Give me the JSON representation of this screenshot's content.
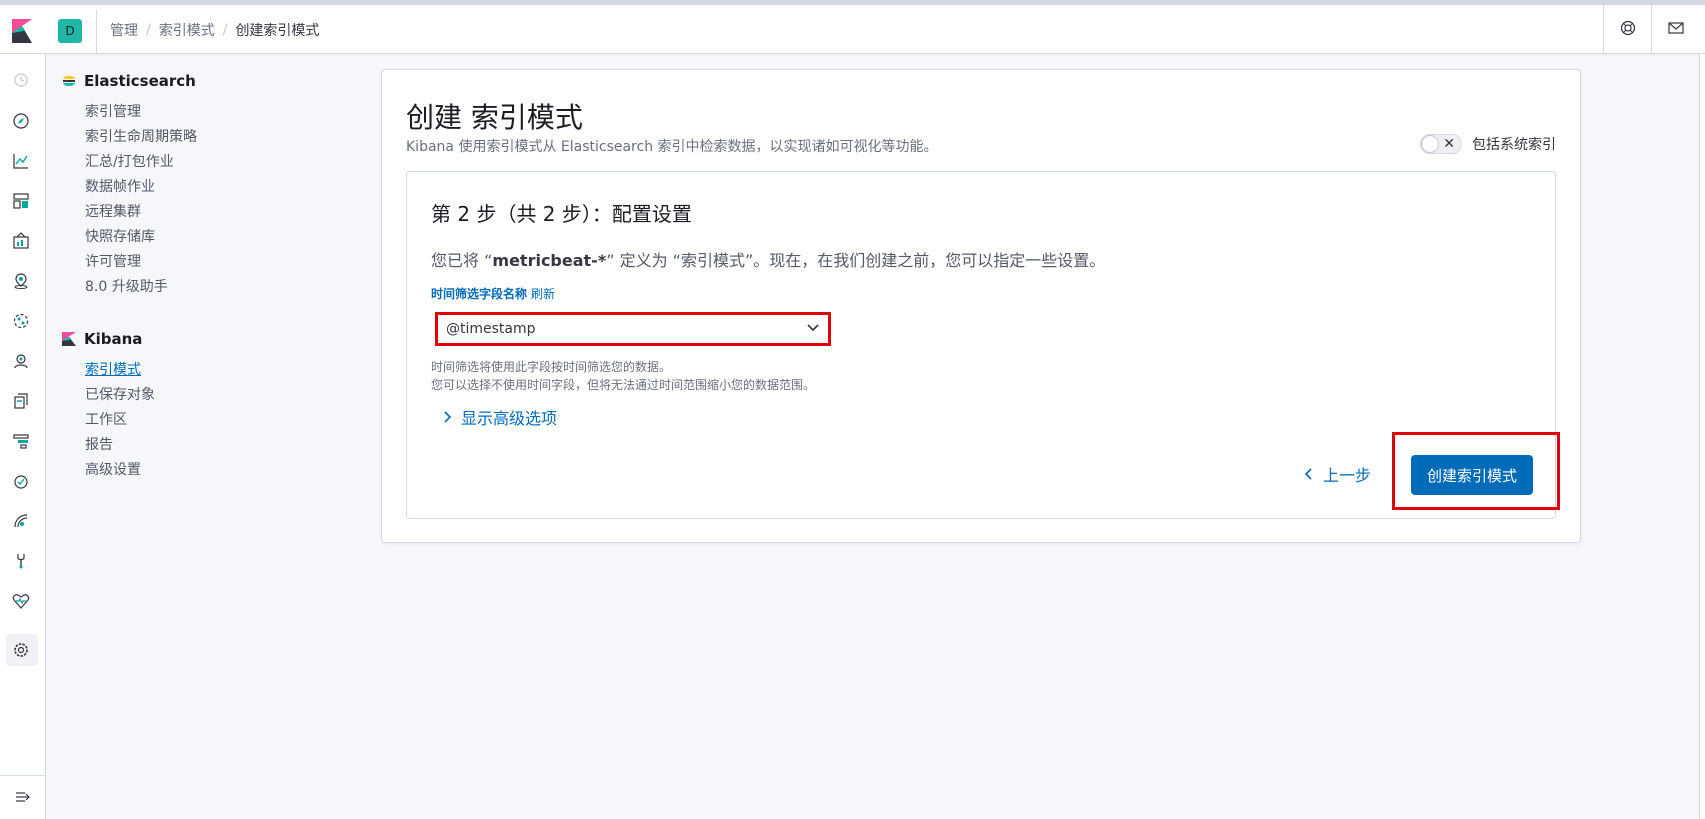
{
  "header": {
    "space_initial": "D",
    "breadcrumbs": [
      "管理",
      "索引模式",
      "创建索引模式"
    ]
  },
  "sidebar": {
    "elasticsearch": {
      "title": "Elasticsearch",
      "items": [
        "索引管理",
        "索引生命周期策略",
        "汇总/打包作业",
        "数据帧作业",
        "远程集群",
        "快照存储库",
        "许可管理",
        "8.0 升级助手"
      ]
    },
    "kibana": {
      "title": "Kibana",
      "items": [
        "索引模式",
        "已保存对象",
        "工作区",
        "报告",
        "高级设置"
      ],
      "selected": "索引模式"
    }
  },
  "main": {
    "title": "创建 索引模式",
    "description": "Kibana 使用索引模式从 Elasticsearch 索引中检索数据，以实现诸如可视化等功能。",
    "system_toggle_label": "包括系统索引",
    "step": {
      "title": "第 2 步（共 2 步）：配置设置",
      "desc_prefix": "您已将 “",
      "pattern": "metricbeat-*",
      "desc_suffix": "” 定义为 “索引模式”。现在，在我们创建之前，您可以指定一些设置。",
      "field_label": "时间筛选字段名称",
      "refresh_label": "刷新",
      "selected_field": "@timestamp",
      "help_line1": "时间筛选将使用此字段按时间筛选您的数据。",
      "help_line2": "您可以选择不使用时间字段，但将无法通过时间范围缩小您的数据范围。",
      "advanced_link": "显示高级选项",
      "back_label": "上一步",
      "create_label": "创建索引模式"
    }
  },
  "colors": {
    "accent": "#006bb8",
    "highlight": "#e0000a",
    "space_badge": "#20b7a6"
  }
}
